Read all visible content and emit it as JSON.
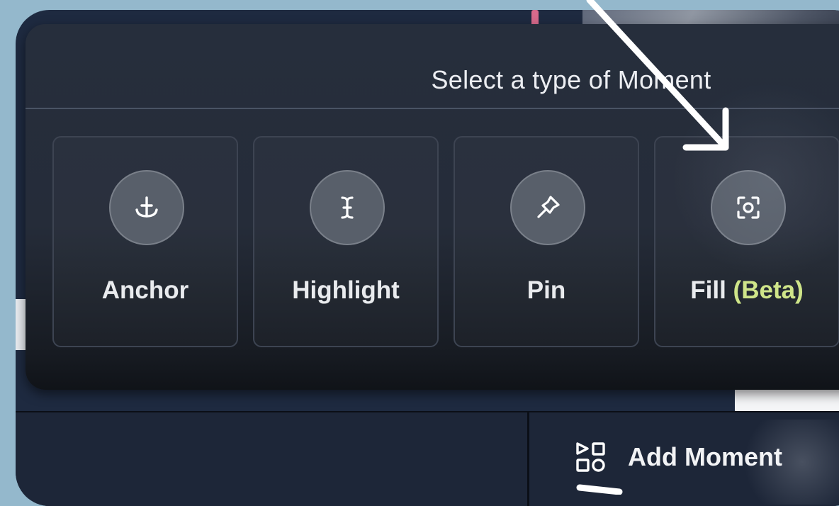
{
  "dialog": {
    "title": "Select a type of Moment"
  },
  "moment_types": [
    {
      "label": "Anchor",
      "icon": "anchor-icon"
    },
    {
      "label": "Highlight",
      "icon": "text-cursor-icon"
    },
    {
      "label": "Pin",
      "icon": "pin-icon"
    },
    {
      "label": "Fill",
      "badge": "(Beta)",
      "icon": "focus-frame-icon"
    }
  ],
  "toolbar": {
    "add_moment_label": "Add Moment",
    "add_moment_icon": "shapes-icon"
  },
  "colors": {
    "page_background": "#94b8cc",
    "panel": "#262e3c",
    "beta_badge": "#cfe589",
    "annotation_arrow": "#ffffff"
  }
}
